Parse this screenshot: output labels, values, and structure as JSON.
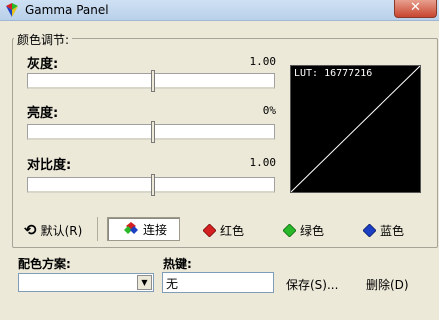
{
  "window": {
    "title": "Gamma Panel",
    "close_label": "✕"
  },
  "group": {
    "title": "颜色调节:"
  },
  "sliders": [
    {
      "label": "灰度:",
      "value": "1.00",
      "position": 0.5
    },
    {
      "label": "亮度:",
      "value": "0%",
      "position": 0.5
    },
    {
      "label": "对比度:",
      "value": "1.00",
      "position": 0.5
    }
  ],
  "lut": {
    "text": "LUT: 16777216"
  },
  "buttons": {
    "default": "默认(R)",
    "link": "连接",
    "red": "红色",
    "green": "绿色",
    "blue": "蓝色"
  },
  "scheme": {
    "label": "配色方案:",
    "value": ""
  },
  "hotkey": {
    "label": "热键:",
    "value": "无"
  },
  "actions": {
    "save": "保存(S)...",
    "delete": "删除(D)"
  },
  "colors": {
    "red": "#d42020",
    "green": "#29b829",
    "blue": "#1d3fc4"
  }
}
